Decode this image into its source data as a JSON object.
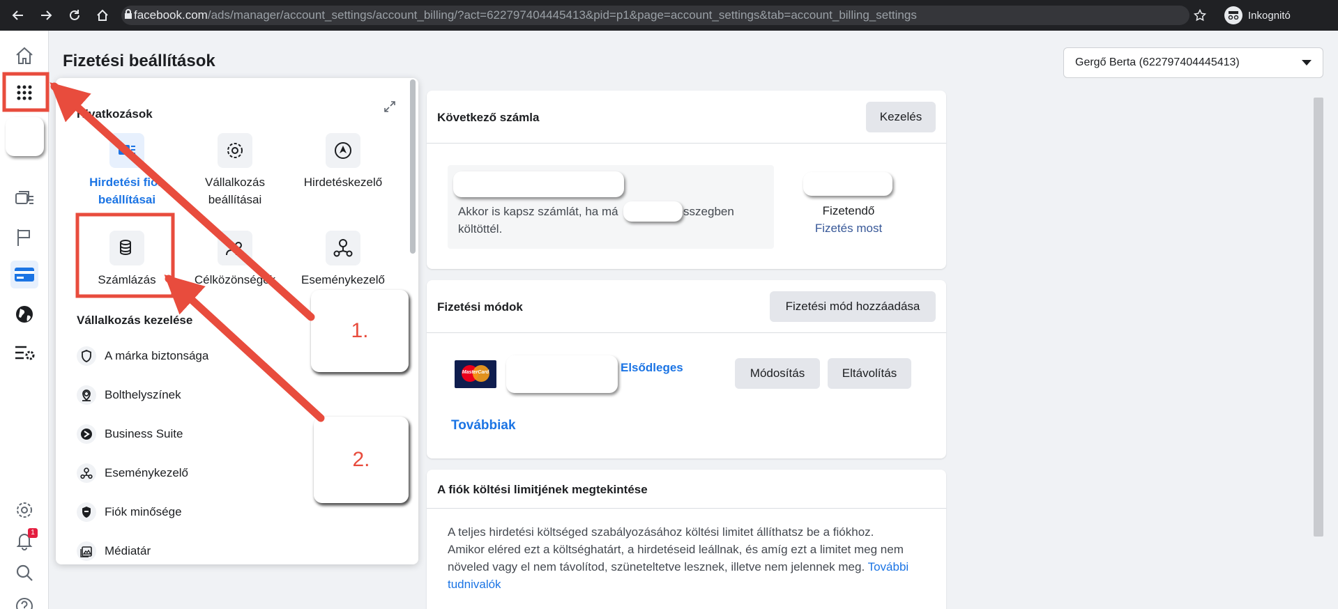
{
  "browser": {
    "url_host": "facebook.com",
    "url_path": "/ads/manager/account_settings/account_billing/?act=622797404445413&pid=p1&page=account_settings&tab=account_billing_settings",
    "incognito_label": "Inkognitó"
  },
  "page": {
    "title": "Fizetési beállítások",
    "account_selector": "Gergő Berta (622797404445413)"
  },
  "rail": {
    "notification_count": "1"
  },
  "menu": {
    "shortcuts_heading": "Hivatkozások",
    "shortcuts": [
      {
        "label": "Hirdetési fiók beállításai",
        "icon": "ad-account-settings-icon"
      },
      {
        "label": "Vállalkozás beállításai",
        "icon": "gear-icon"
      },
      {
        "label": "Hirdetéskezelő",
        "icon": "ads-manager-icon"
      },
      {
        "label": "Számlázás",
        "icon": "billing-icon"
      },
      {
        "label": "Célközönségek",
        "icon": "audiences-icon"
      },
      {
        "label": "Eseménykezelő",
        "icon": "events-manager-icon"
      }
    ],
    "business_heading": "Vállalkozás kezelése",
    "business_items": [
      {
        "label": "A márka biztonsága",
        "icon": "shield-icon"
      },
      {
        "label": "Bolthelyszínek",
        "icon": "location-pin-icon"
      },
      {
        "label": "Business Suite",
        "icon": "business-suite-icon"
      },
      {
        "label": "Eseménykezelő",
        "icon": "events-manager-icon"
      },
      {
        "label": "Fiók minősége",
        "icon": "account-quality-icon"
      },
      {
        "label": "Médiatár",
        "icon": "media-library-icon"
      }
    ]
  },
  "next_invoice": {
    "title": "Következő számla",
    "manage_button": "Kezelés",
    "text_before": "Akkor is kapsz számlát, ha má",
    "text_after": "összegben",
    "text_line2": "költöttél.",
    "due_label": "Fizetendő",
    "pay_now": "Fizetés most"
  },
  "payment_methods": {
    "title": "Fizetési módok",
    "add_button": "Fizetési mód hozzáadása",
    "card_brand": "MasterCard",
    "primary_label": "Elsődleges",
    "edit_button": "Módosítás",
    "remove_button": "Eltávolítás",
    "more_link": "Továbbiak"
  },
  "spending_limit": {
    "title": "A fiók költési limitjének megtekintése",
    "line1": "A teljes hirdetési költséged szabályozásához költési limitet állíthatsz be a fiókhoz.",
    "line2": "Amikor eléred ezt a költséghatárt, a hirdetéseid leállnak, és amíg ezt a limitet meg nem",
    "line3": "növeled vagy el nem távolítod, szüneteltetve lesznek, illetve nem jelennek meg.",
    "learn_more_1": "További",
    "learn_more_2": "tudnivalók"
  },
  "annotations": {
    "step1": "1.",
    "step2": "2.",
    "color": "#e84c3d"
  }
}
